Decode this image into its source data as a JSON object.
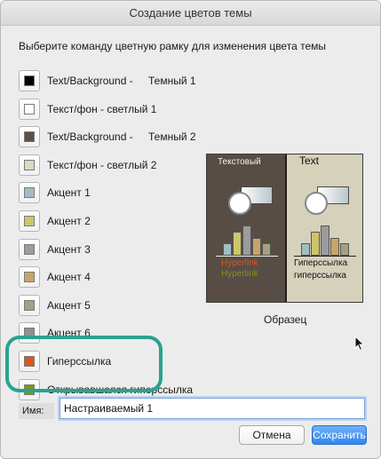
{
  "window": {
    "title": "Создание цветов темы"
  },
  "instruction": "Выберите команду цветную рамку для изменения цвета темы",
  "colors": [
    {
      "label": "Text/Background -",
      "label2": "Темный 1",
      "color": "#000000"
    },
    {
      "label": "Текст/фон - светлый 1",
      "label2": "",
      "color": "#ffffff"
    },
    {
      "label": "Text/Background -",
      "label2": "Темный 2",
      "color": "#5a5049"
    },
    {
      "label": "Текст/фон - светлый 2",
      "label2": "",
      "color": "#dcd9c0"
    },
    {
      "label": "Акцент 1",
      "label2": "",
      "color": "#9fbfc2"
    },
    {
      "label": "Акцент 2",
      "label2": "",
      "color": "#cdc56a"
    },
    {
      "label": "Акцент 3",
      "label2": "",
      "color": "#9c9c9c"
    },
    {
      "label": "Акцент 4",
      "label2": "",
      "color": "#c9a469"
    },
    {
      "label": "Акцент 5",
      "label2": "",
      "color": "#a7a07d"
    },
    {
      "label": "Акцент 6",
      "label2": "",
      "color": "#8c9390"
    },
    {
      "label": "Гиперссылка",
      "label2": "",
      "color": "#d65a1c"
    },
    {
      "label": "Открывавшаяся гиперссылка",
      "label2": "",
      "color": "#7f961a"
    }
  ],
  "preview": {
    "left_title": "Текстовый",
    "right_title": "Text",
    "left_link1": "Hyperlink",
    "left_link2": "Hyperlink",
    "right_link1": "Гиперссылка",
    "right_link2": "гиперссылка",
    "sample_label": "Образец",
    "bar_values": [
      2,
      4,
      5,
      3,
      2
    ],
    "bar_colors": [
      "#9fbfc2",
      "#cdc56a",
      "#9c9c9c",
      "#c9a469",
      "#a7a07d"
    ],
    "link_color": "#d65a1c",
    "visited_color": "#7f961a"
  },
  "name_field": {
    "label": "Имя:",
    "value": "Настраиваемый 1"
  },
  "buttons": {
    "cancel": "Отмена",
    "save": "Сохранить"
  }
}
